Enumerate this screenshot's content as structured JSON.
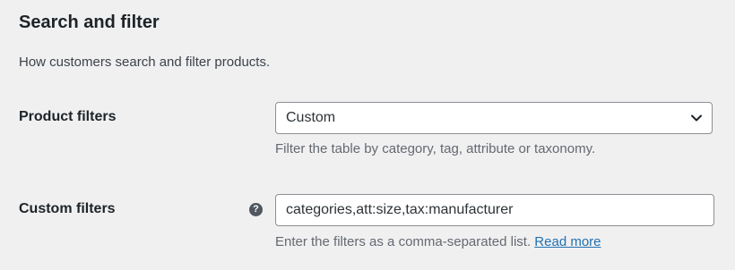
{
  "section": {
    "title": "Search and filter",
    "description": "How customers search and filter products."
  },
  "product_filters": {
    "label": "Product filters",
    "selected": "Custom",
    "help": "Filter the table by category, tag, attribute or taxonomy.",
    "chevron_icon": "chevron-down-icon"
  },
  "custom_filters": {
    "label": "Custom filters",
    "help_icon": "question-circle-icon",
    "help_icon_glyph": "?",
    "value": "categories,att:size,tax:manufacturer",
    "help": "Enter the filters as a comma-separated list.",
    "link_text": "Read more"
  },
  "colors": {
    "background": "#f0f0f1",
    "link": "#2271b1",
    "border": "#8c8f94"
  }
}
